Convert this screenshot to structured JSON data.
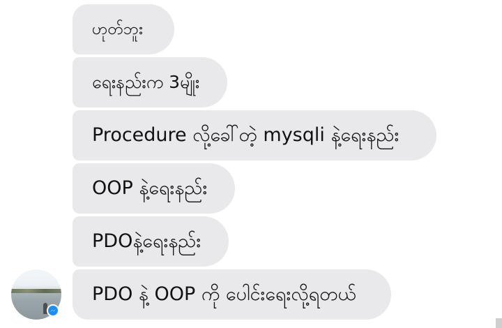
{
  "conversation": {
    "messages": [
      {
        "text": "ဟုတ်ဘူး"
      },
      {
        "text": "ရေးနည်းက 3မျိုး"
      },
      {
        "text": "Procedure လို့ခေါ်တဲ့ mysqli နဲ့ရေးနည်း"
      },
      {
        "text": "OOP နဲ့ရေးနည်း"
      },
      {
        "text": "PDOနဲ့ရေးနည်း"
      },
      {
        "text": "PDO နဲ့ OOP ကို ပေါင်းရေးလို့ရတယ်"
      }
    ]
  },
  "sender": {
    "avatar_icon": "profile-photo",
    "badge_icon": "messenger-icon",
    "badge_color": "#1e8ef7"
  },
  "colors": {
    "bubble_bg": "#e9e9eb",
    "text": "#111111",
    "page_bg": "#ffffff"
  }
}
